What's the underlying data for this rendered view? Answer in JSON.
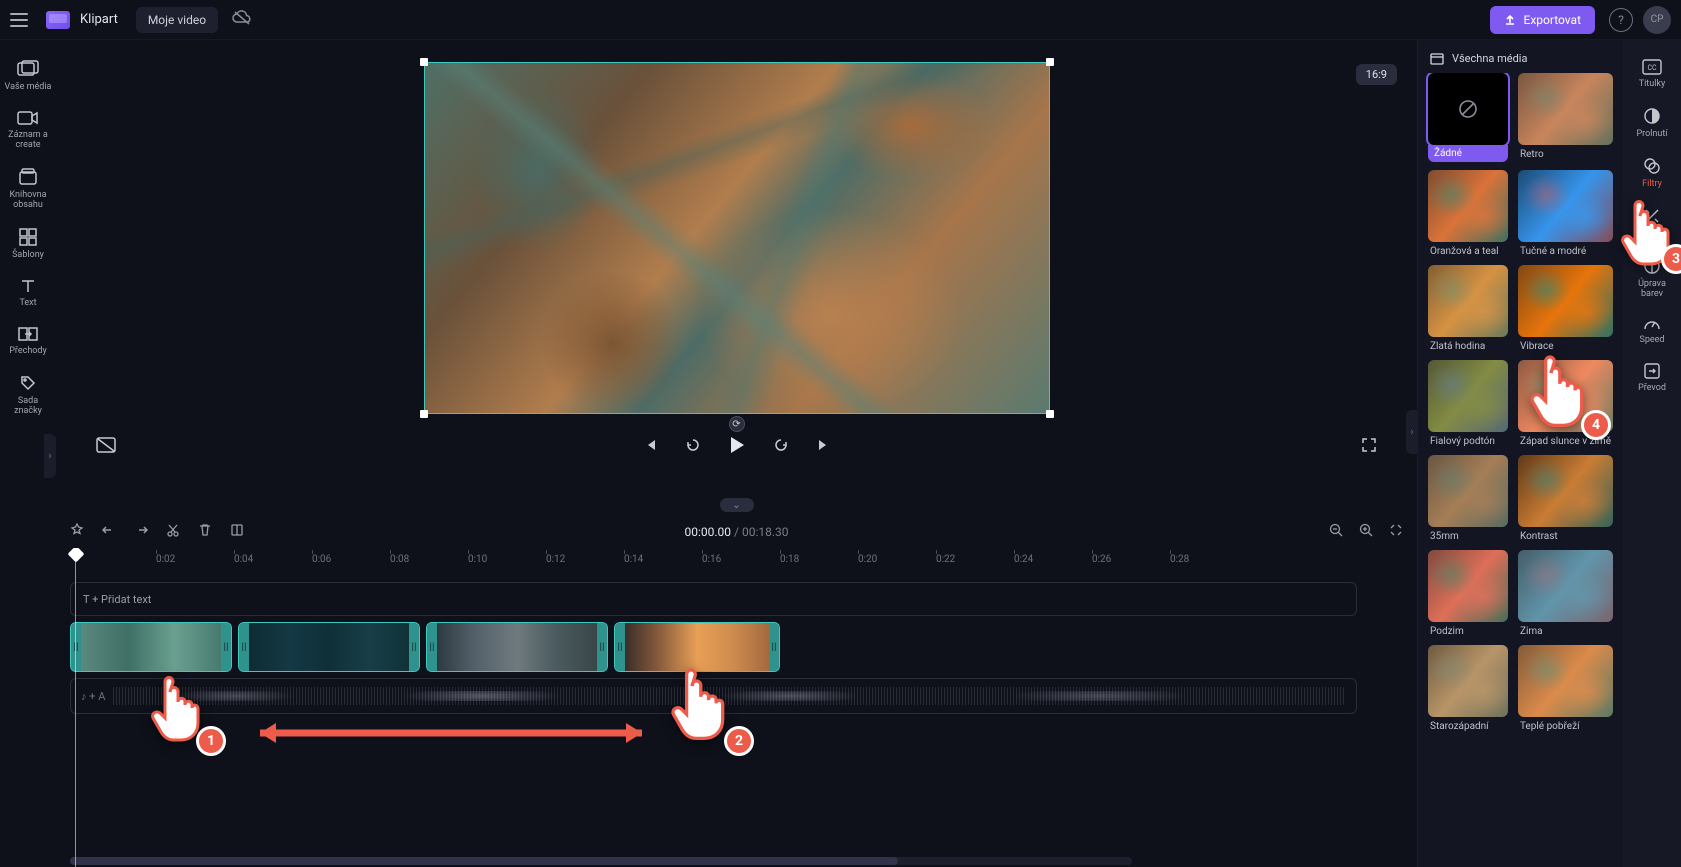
{
  "app": {
    "title": "Klipart",
    "project_name": "Moje video"
  },
  "export": {
    "label": "Exportovat"
  },
  "avatar": {
    "initials": "CP"
  },
  "aspect": {
    "label": "16:9"
  },
  "playback": {
    "current": "00:00.00",
    "total": "00:18.30"
  },
  "left_rail": [
    {
      "id": "your-media",
      "label": "Vaše média"
    },
    {
      "id": "record",
      "label": "Záznam a create"
    },
    {
      "id": "library",
      "label": "Knihovna obsahu"
    },
    {
      "id": "templates",
      "label": "Šablony"
    },
    {
      "id": "text",
      "label": "Text"
    },
    {
      "id": "transitions",
      "label": "Přechody"
    },
    {
      "id": "brand",
      "label": "Sada značky"
    }
  ],
  "ruler_ticks": [
    "0:02",
    "0:04",
    "0:06",
    "0:08",
    "0:10",
    "0:12",
    "0:14",
    "0:16",
    "0:18",
    "0:20",
    "0:22",
    "0:24",
    "0:26",
    "0:28"
  ],
  "tracks": {
    "text_label": "T + Přidat text",
    "audio_label": "+ A"
  },
  "filters": {
    "header": "Všechna média",
    "items": [
      {
        "id": "none",
        "name": "Žádné",
        "variant": "none",
        "selected": true
      },
      {
        "id": "retro",
        "name": "Retro",
        "variant": "ft-retro"
      },
      {
        "id": "orange",
        "name": "Oranžová a teal",
        "variant": "ft-orange"
      },
      {
        "id": "bold",
        "name": "Tučné a modré",
        "variant": "ft-bold"
      },
      {
        "id": "golden",
        "name": "Zlatá hodina",
        "variant": "ft-gold"
      },
      {
        "id": "vibr",
        "name": "Vibrace",
        "variant": "ft-vibr"
      },
      {
        "id": "violet",
        "name": "Fialový podtón",
        "variant": "ft-viol"
      },
      {
        "id": "sunset",
        "name": "Západ slunce v zimě",
        "variant": "ft-suns"
      },
      {
        "id": "35mm",
        "name": "35mm",
        "variant": "ft-35mm"
      },
      {
        "id": "contrast",
        "name": "Kontrast",
        "variant": "ft-cont"
      },
      {
        "id": "fall",
        "name": "Podzim",
        "variant": "ft-fall"
      },
      {
        "id": "winter",
        "name": "Zima",
        "variant": "ft-wint"
      },
      {
        "id": "oldwest",
        "name": "Starozápadní",
        "variant": "ft-oldw"
      },
      {
        "id": "warm",
        "name": "Teplé pobřeží",
        "variant": "ft-warm"
      }
    ]
  },
  "prop_rail": [
    {
      "id": "captions",
      "label": "Titulky"
    },
    {
      "id": "fade",
      "label": "Prolnutí"
    },
    {
      "id": "filters",
      "label": "Filtry",
      "active": true
    },
    {
      "id": "effects",
      "label": "Efekty",
      "active": true
    },
    {
      "id": "color",
      "label": "Úprava barev"
    },
    {
      "id": "speed",
      "label": "Speed"
    },
    {
      "id": "convert",
      "label": "Převod"
    }
  ],
  "annotations": {
    "b1": "1",
    "b2": "2",
    "b3": "3",
    "b4": "4"
  }
}
